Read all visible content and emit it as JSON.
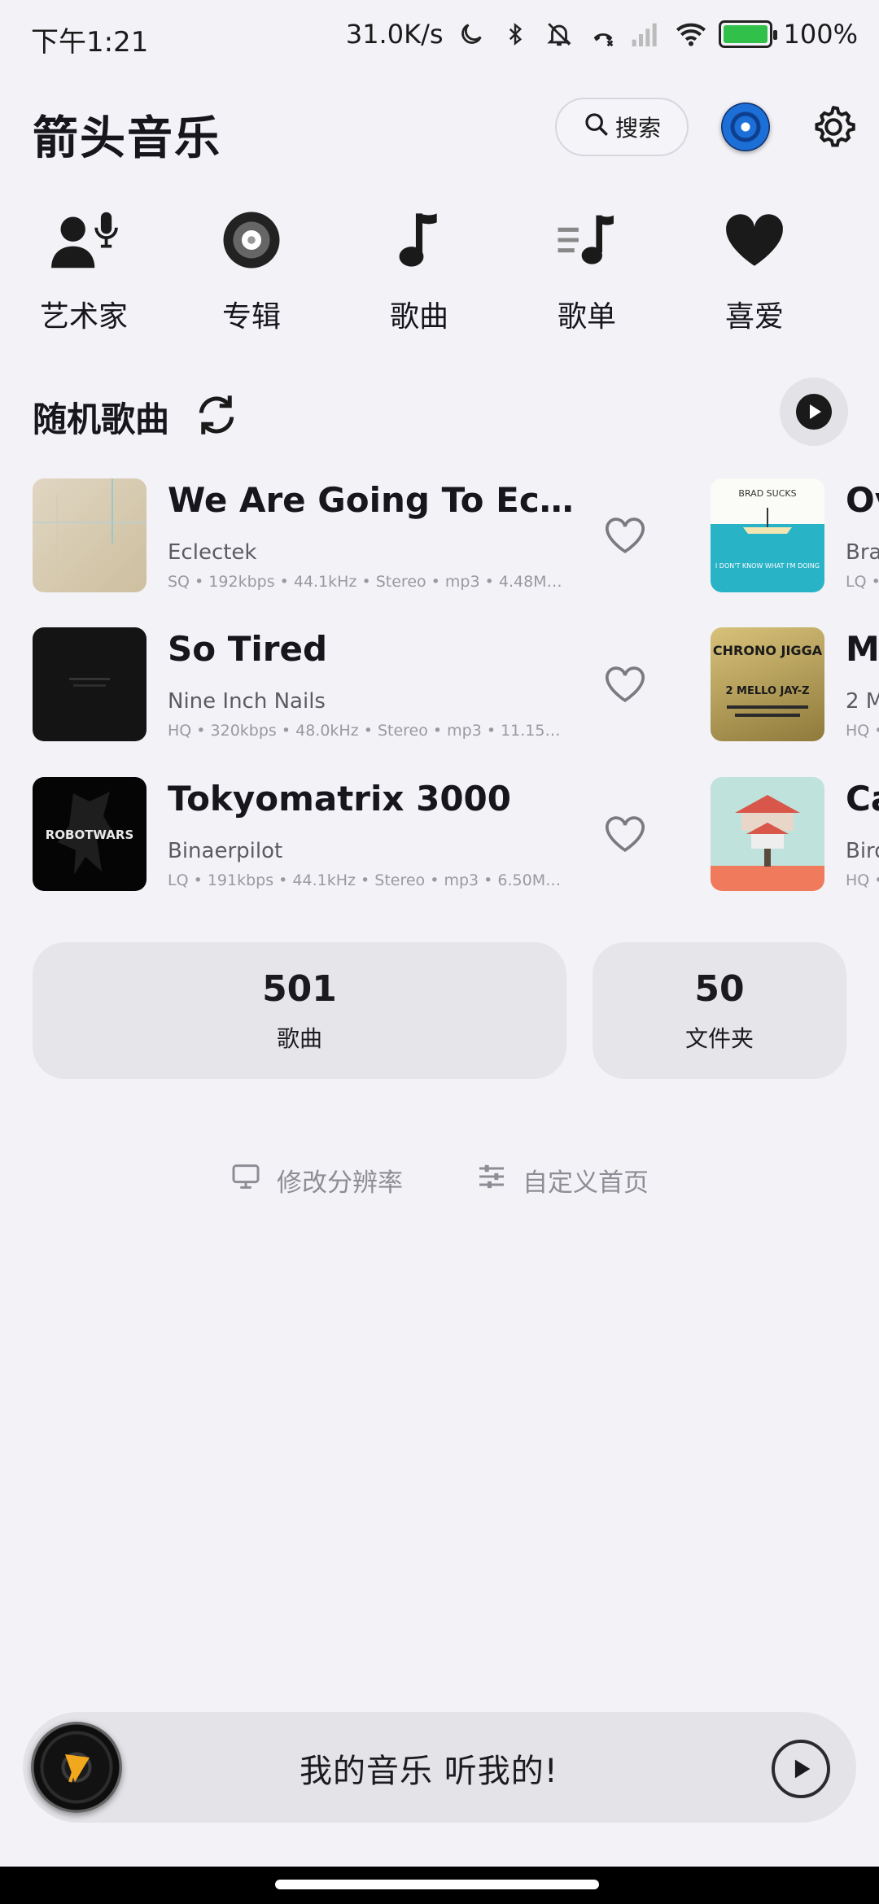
{
  "status_bar": {
    "time": "下午1:21",
    "speed": "31.0K/s",
    "battery": "100%"
  },
  "header": {
    "title": "箭头音乐",
    "search_label": "搜索"
  },
  "categories": [
    {
      "label": "艺术家",
      "icon": "artist-mic-icon"
    },
    {
      "label": "专辑",
      "icon": "album-disc-icon"
    },
    {
      "label": "歌曲",
      "icon": "music-note-icon"
    },
    {
      "label": "歌单",
      "icon": "playlist-icon"
    },
    {
      "label": "喜爱",
      "icon": "heart-icon"
    }
  ],
  "random_section": {
    "title": "随机歌曲"
  },
  "songs": [
    {
      "title": "We Are Going To Eclecf…",
      "artist": "Eclectek",
      "meta": "SQ • 192kbps • 44.1kHz • Stereo • mp3 • 4.48M…"
    },
    {
      "title": "So Tired",
      "artist": "Nine Inch Nails",
      "meta": "HQ • 320kbps • 48.0kHz • Stereo • mp3 • 11.15…"
    },
    {
      "title": "Tokyomatrix 3000",
      "artist": "Binaerpilot",
      "meta": "LQ • 191kbps • 44.1kHz • Stereo • mp3 • 6.50M…"
    }
  ],
  "songs_right": [
    {
      "title": "Ov",
      "artist": "Bra",
      "meta": "LQ •"
    },
    {
      "title": "Ma",
      "artist": "2 M",
      "meta": "HQ •"
    },
    {
      "title": "Ca",
      "artist": "Bird",
      "meta": "HQ •"
    }
  ],
  "covers": {
    "song2_text": "ROBOTWARS",
    "right1_top": "BRAD SUCKS",
    "right1_bottom": "I DON'T KNOW WHAT I'M DOING",
    "right2_text": "CHRONO JIGGA",
    "right2_sub": "2 MELLO JAY-Z"
  },
  "stats": [
    {
      "value": "501",
      "label": "歌曲"
    },
    {
      "value": "50",
      "label": "文件夹"
    }
  ],
  "links": {
    "resolution": "修改分辨率",
    "customize": "自定义首页"
  },
  "mini_player": {
    "text": "我的音乐 听我的!"
  },
  "colors": {
    "background": "#f3f2f7",
    "card": "#e6e5ea",
    "accent_blue": "#1d6fd8"
  }
}
